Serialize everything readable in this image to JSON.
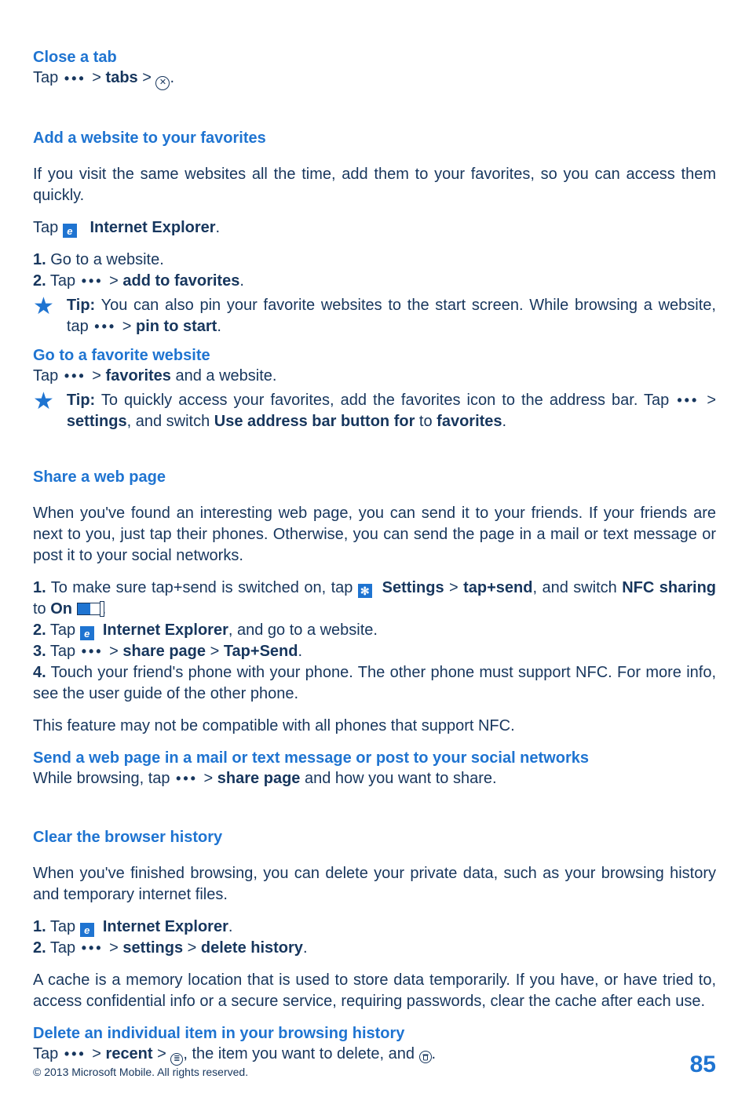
{
  "closeTab": {
    "heading": "Close a tab",
    "line_pre": "Tap ",
    "tabs": "tabs"
  },
  "addFav": {
    "heading": "Add a website to your favorites",
    "intro": "If you visit the same websites all the time, add them to your favorites, so you can access them quickly.",
    "tap": "Tap ",
    "ie": "Internet Explorer",
    "step1_num": "1.",
    "step1": " Go to a website.",
    "step2_num": "2.",
    "step2_pre": " Tap ",
    "addto": "add to favorites",
    "tip_label": "Tip:",
    "tip_text": " You can also pin your favorite websites to the start screen. While browsing a website, tap ",
    "pin": "pin to start"
  },
  "gotoFav": {
    "heading": "Go to a favorite website",
    "line_pre": "Tap ",
    "favorites": "favorites",
    "line_post": " and a website.",
    "tip_label": "Tip:",
    "tip_text1": " To quickly access your favorites, add the favorites icon to the address bar. Tap ",
    "tip_text2": "settings",
    "tip_text3": ", and switch ",
    "tip_text4": "Use address bar button for",
    "tip_text5": " to ",
    "tip_text6": "favorites"
  },
  "share": {
    "heading": "Share a web page",
    "intro": "When you've found an interesting web page, you can send it to your friends. If your friends are next to you, just tap their phones. Otherwise, you can send the page in a mail or text message or post it to your social networks.",
    "s1_num": "1.",
    "s1_a": " To make sure tap+send is switched on, tap ",
    "s1_settings": "Settings",
    "s1_tapsend": "tap+send",
    "s1_switch": ", and switch ",
    "s1_nfc": "NFC sharing",
    "s1_to": " to ",
    "s1_on": "On",
    "s2_num": "2.",
    "s2_pre": " Tap ",
    "s2_ie": "Internet Explorer",
    "s2_post": ", and go to a website.",
    "s3_num": "3.",
    "s3_pre": " Tap ",
    "s3_share": "share page",
    "s3_tap": "Tap+Send",
    "s4_num": "4.",
    "s4": " Touch your friend's phone with your phone. The other phone must support NFC. For more info, see the user guide of the other phone.",
    "note": "This feature may not be compatible with all phones that support NFC."
  },
  "sendPage": {
    "heading": "Send a web page in a mail or text message or post to your social networks",
    "line_pre": "While browsing, tap ",
    "share": "share page",
    "line_post": " and how you want to share."
  },
  "clear": {
    "heading": "Clear the browser history",
    "intro": "When you've finished browsing, you can delete your private data, such as your browsing history and temporary internet files.",
    "s1_num": "1.",
    "s1_pre": " Tap ",
    "s1_ie": "Internet Explorer",
    "s2_num": "2.",
    "s2_pre": " Tap ",
    "s2_settings": "settings",
    "s2_delete": "delete history",
    "cache": "A cache is a memory location that is used to store data temporarily. If you have, or have tried to, access confidential info or a secure service, requiring passwords, clear the cache after each use."
  },
  "deleteItem": {
    "heading": "Delete an individual item in your browsing history",
    "line_pre": "Tap ",
    "recent": "recent",
    "mid": ", the item you want to delete, and "
  },
  "footer": {
    "copyright": "© 2013 Microsoft Mobile. All rights reserved.",
    "page": "85"
  },
  "glyph": {
    "gt": " > ",
    "dot": "."
  }
}
